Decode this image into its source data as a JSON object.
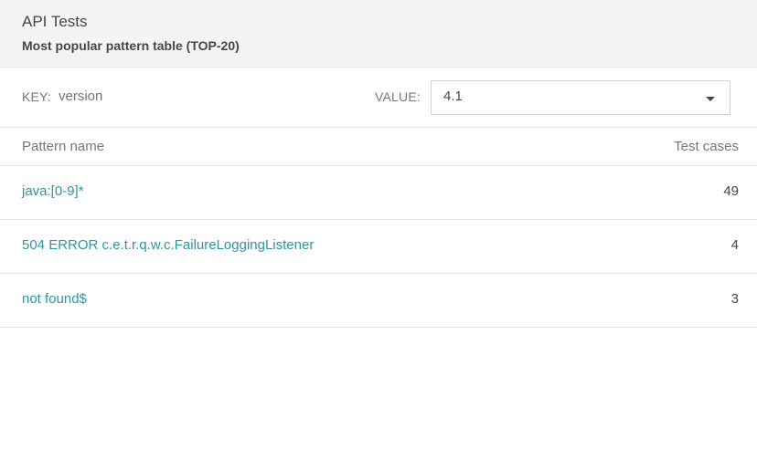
{
  "header": {
    "title": "API Tests",
    "subtitle": "Most popular pattern table (TOP-20)"
  },
  "filter": {
    "key_label": "KEY:",
    "key_value": "version",
    "value_label": "VALUE:",
    "value_selected": "4.1"
  },
  "table": {
    "col_name": "Pattern name",
    "col_count": "Test cases",
    "rows": [
      {
        "pattern": "java:[0-9]*",
        "count": "49"
      },
      {
        "pattern": "504 ERROR c.e.t.r.q.w.c.FailureLoggingListener",
        "count": "4"
      },
      {
        "pattern": "not found$",
        "count": "3"
      }
    ]
  },
  "colors": {
    "link": "#2c97a3",
    "header_bg": "#f4f4f4",
    "text": "#464547",
    "muted": "#767676"
  },
  "icons": {
    "dropdown": "chevron-down-icon"
  }
}
